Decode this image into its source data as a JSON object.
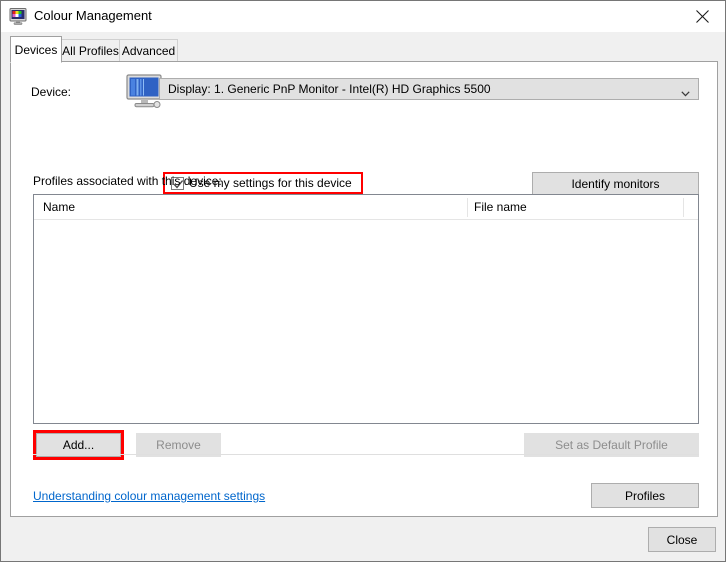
{
  "window": {
    "title": "Colour Management",
    "icon": "colour-monitor-icon",
    "close_icon": "close-icon"
  },
  "tabs": [
    {
      "label": "Devices",
      "active": true
    },
    {
      "label": "All Profiles",
      "active": false
    },
    {
      "label": "Advanced",
      "active": false
    }
  ],
  "device_section": {
    "label": "Device:",
    "icon": "monitor-icon",
    "selected_device": "Display: 1. Generic PnP Monitor - Intel(R) HD Graphics 5500",
    "dropdown_icon": "chevron-down-icon",
    "checkbox": {
      "label": "Use my settings for this device",
      "checked": true,
      "highlighted": true
    },
    "identify_button": "Identify monitors"
  },
  "profiles_section": {
    "label": "Profiles associated with this device:",
    "columns": [
      "Name",
      "File name"
    ],
    "rows": []
  },
  "profile_buttons": {
    "add": "Add...",
    "add_highlighted": true,
    "remove": "Remove",
    "remove_enabled": false,
    "set_default": "Set as Default Profile",
    "set_default_enabled": false
  },
  "link": "Understanding colour management settings",
  "profiles_button": "Profiles",
  "close_button": "Close",
  "colors": {
    "highlight": "#ff0000",
    "link": "#0066cc",
    "window_bg": "#f0f0f0",
    "panel_bg": "#ffffff",
    "button_bg": "#e1e1e1",
    "disabled_text": "#8d8d8d"
  }
}
